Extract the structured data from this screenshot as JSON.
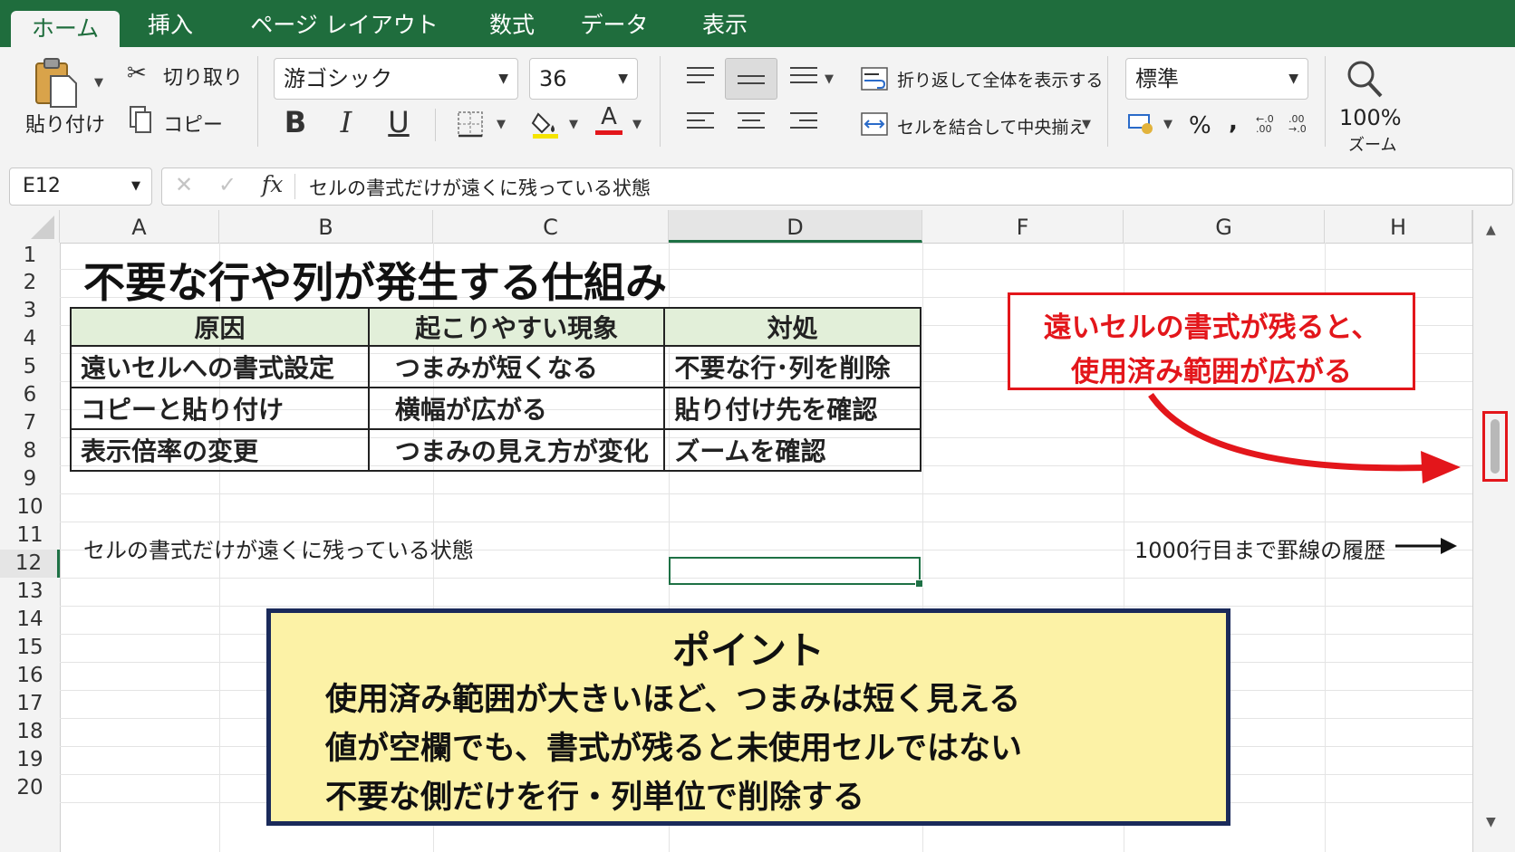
{
  "ribbon_tabs": [
    {
      "label": "ホーム",
      "active": true
    },
    {
      "label": "挿入",
      "active": false
    },
    {
      "label": "ページ レイアウト",
      "active": false
    },
    {
      "label": "数式",
      "active": false
    },
    {
      "label": "データ",
      "active": false
    },
    {
      "label": "表示",
      "active": false
    }
  ],
  "clipboard": {
    "paste_label": "貼り付け",
    "cut_label": "切り取り",
    "copy_label": "コピー"
  },
  "font": {
    "name": "游ゴシック",
    "size": "36",
    "bold": "B",
    "italic": "I",
    "underline": "U",
    "font_color_glyph": "A"
  },
  "alignment": {
    "wrap_label": "折り返して全体を表示する",
    "merge_label": "セルを結合して中央揃え"
  },
  "number": {
    "format": "標準",
    "percent": "%",
    "comma": ","
  },
  "zoom": {
    "value": "100%",
    "label": "ズーム"
  },
  "formula_bar": {
    "name_box": "E12",
    "fx": "fx",
    "formula": "セルの書式だけが遠くに残っている状態"
  },
  "columns": [
    "A",
    "B",
    "C",
    "D",
    "F",
    "G",
    "H"
  ],
  "rows": [
    "1",
    "2",
    "3",
    "4",
    "5",
    "6",
    "7",
    "8",
    "9",
    "10",
    "11",
    "12",
    "13",
    "14",
    "15",
    "16",
    "17",
    "18",
    "19",
    "20"
  ],
  "sheet": {
    "title": "不要な行や列が発生する仕組み",
    "table_headers": [
      "原因",
      "起こりやすい現象",
      "対処"
    ],
    "table_rows": [
      [
        "遠いセルへの書式設定",
        "つまみが短くなる",
        "不要な行･列を削除"
      ],
      [
        "コピーと貼り付け",
        "横幅が広がる",
        "貼り付け先を確認"
      ],
      [
        "表示倍率の変更",
        "つまみの見え方が変化",
        "ズームを確認"
      ]
    ],
    "note_row10": "セルの書式だけが遠くに残っている状態",
    "history_label": "1000行目まで罫線の履歴"
  },
  "callout": {
    "line1": "遠いセルの書式が残ると、",
    "line2": "使用済み範囲が広がる"
  },
  "point_box": {
    "title": "ポイント",
    "lines": [
      "使用済み範囲が大きいほど、つまみは短く見える",
      "値が空欄でも、書式が残ると未使用セルではない",
      "不要な側だけを行・列単位で削除する"
    ]
  },
  "colors": {
    "ribbon_green": "#1f6d3d",
    "header_fill": "#e2efd9",
    "callout_red": "#e3161b",
    "point_fill": "#fcf2a6",
    "point_border": "#1a2a5a",
    "selection": "#1e7145"
  }
}
